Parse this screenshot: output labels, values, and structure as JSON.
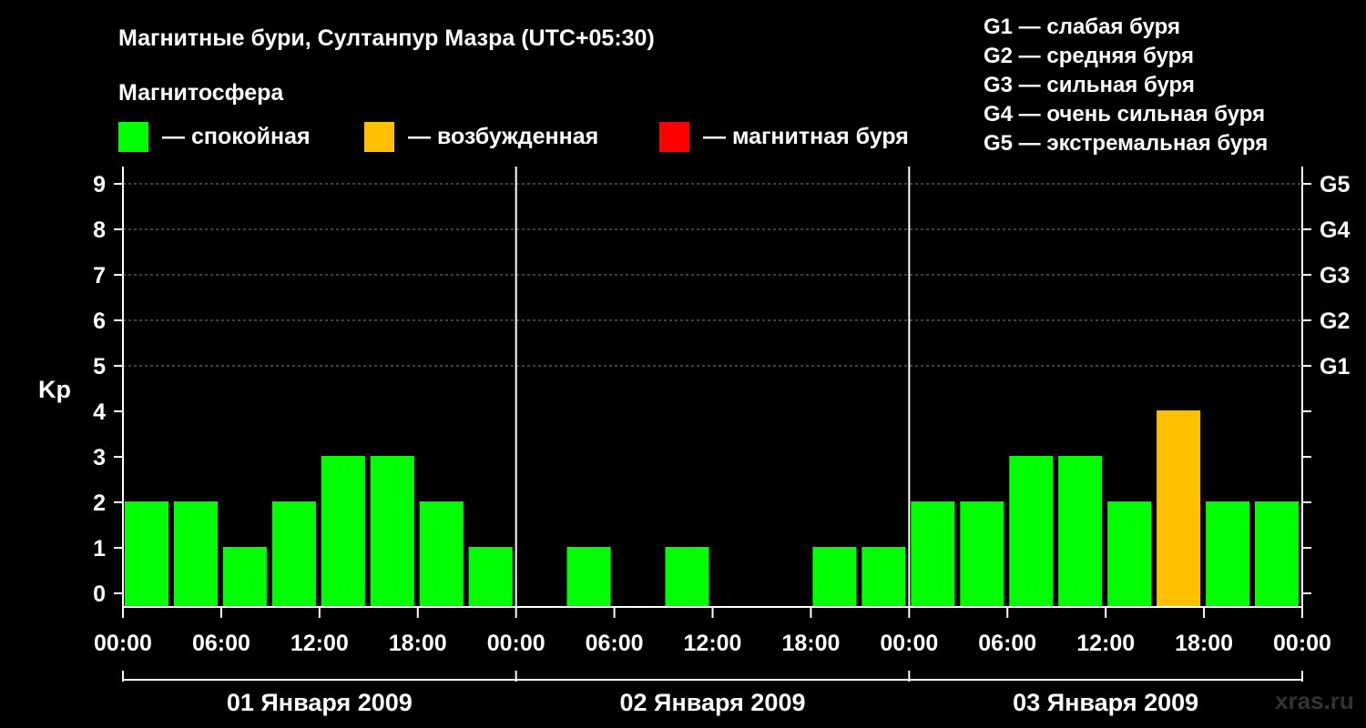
{
  "title": "Магнитные бури, Султанпур Мазра (UTC+05:30)",
  "legend_title": "Магнитосфера",
  "legend": [
    {
      "label": "— спокойная",
      "color": "#00ff00"
    },
    {
      "label": "— возбужденная",
      "color": "#ffc000"
    },
    {
      "label": "— магнитная буря",
      "color": "#ff0000"
    }
  ],
  "g_scale": [
    "G1 — слабая буря",
    "G2 — средняя буря",
    "G3 — сильная буря",
    "G4 — очень сильная буря",
    "G5 — экстремальная буря"
  ],
  "watermark": "xras.ru",
  "colors": {
    "background": "#000000",
    "text": "#ffffff",
    "grid": "#808080",
    "quiet": "#00ff00",
    "active": "#ffc000",
    "storm": "#ff0000"
  },
  "chart_data": {
    "type": "bar",
    "ylabel": "Kp",
    "ylim": [
      0,
      9
    ],
    "y_ticks": [
      "0",
      "1",
      "2",
      "3",
      "4",
      "5",
      "6",
      "7",
      "8",
      "9"
    ],
    "right_ticks": [
      {
        "value": 5,
        "label": "G1"
      },
      {
        "value": 6,
        "label": "G2"
      },
      {
        "value": 7,
        "label": "G3"
      },
      {
        "value": 8,
        "label": "G4"
      },
      {
        "value": 9,
        "label": "G5"
      }
    ],
    "grid": "dashed horizontal at 5–9",
    "x_tick_labels": [
      "00:00",
      "06:00",
      "12:00",
      "18:00",
      "00:00",
      "06:00",
      "12:00",
      "18:00",
      "00:00",
      "06:00",
      "12:00",
      "18:00",
      "00:00"
    ],
    "days": [
      "01 Января 2009",
      "02 Января 2009",
      "03 Января 2009"
    ],
    "interval_hours": 3,
    "values": [
      2,
      2,
      1,
      2,
      3,
      3,
      2,
      1,
      0,
      1,
      0,
      1,
      0,
      0,
      1,
      1,
      2,
      2,
      3,
      3,
      2,
      4,
      2,
      2
    ],
    "bar_status": [
      "quiet",
      "quiet",
      "quiet",
      "quiet",
      "quiet",
      "quiet",
      "quiet",
      "quiet",
      "quiet",
      "quiet",
      "quiet",
      "quiet",
      "quiet",
      "quiet",
      "quiet",
      "quiet",
      "quiet",
      "quiet",
      "quiet",
      "quiet",
      "quiet",
      "active",
      "quiet",
      "quiet"
    ]
  }
}
